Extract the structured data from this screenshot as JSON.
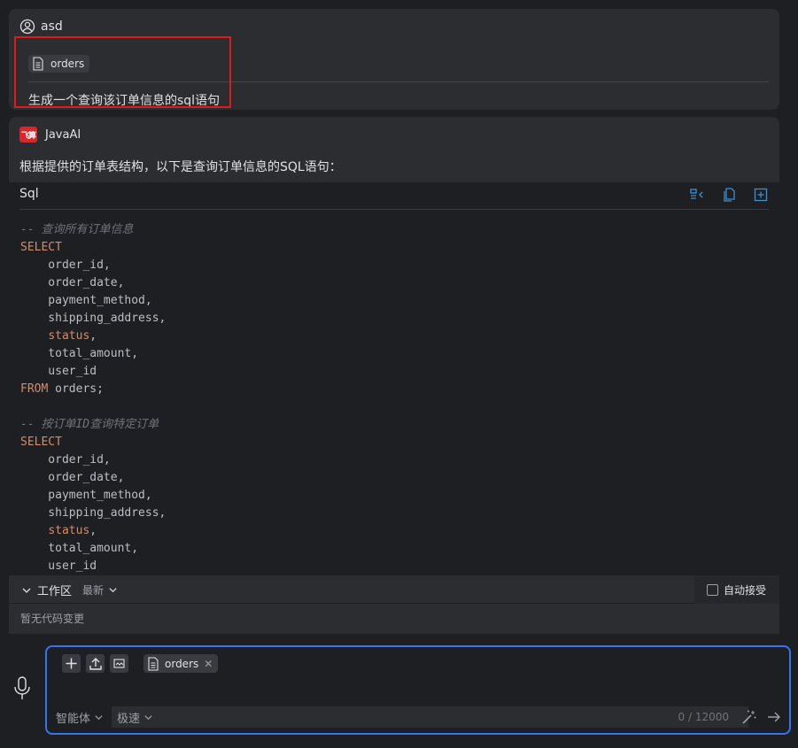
{
  "user_message": {
    "username": "asd",
    "attachment": "orders",
    "text": "生成一个查询该订单信息的sql语句"
  },
  "ai_message": {
    "logo_text": "飞算",
    "name": "JavaAI",
    "intro": "根据提供的订单表结构，以下是查询订单信息的SQL语句：",
    "code_language": "Sql",
    "code_lines": [
      "-- 查询所有订单信息",
      "SELECT",
      "    order_id,",
      "    order_date,",
      "    payment_method,",
      "    shipping_address,",
      "    status,",
      "    total_amount,",
      "    user_id",
      "FROM orders;",
      "",
      "-- 按订单ID查询特定订单",
      "SELECT",
      "    order_id,",
      "    order_date,",
      "    payment_method,",
      "    shipping_address,",
      "    status,",
      "    total_amount,",
      "    user_id"
    ]
  },
  "workspace": {
    "title": "工作区",
    "sort": "最新",
    "auto_accept": "自动接受",
    "empty": "暂无代码变更"
  },
  "input": {
    "attachment": "orders",
    "agent_mode": "智能体",
    "speed_mode": "极速",
    "counter": "0 / 12000",
    "value": ""
  },
  "colors": {
    "accent": "#3574f0",
    "highlight": "#e0191b",
    "keyword": "#cf8e6d",
    "comment": "#6f737a"
  }
}
